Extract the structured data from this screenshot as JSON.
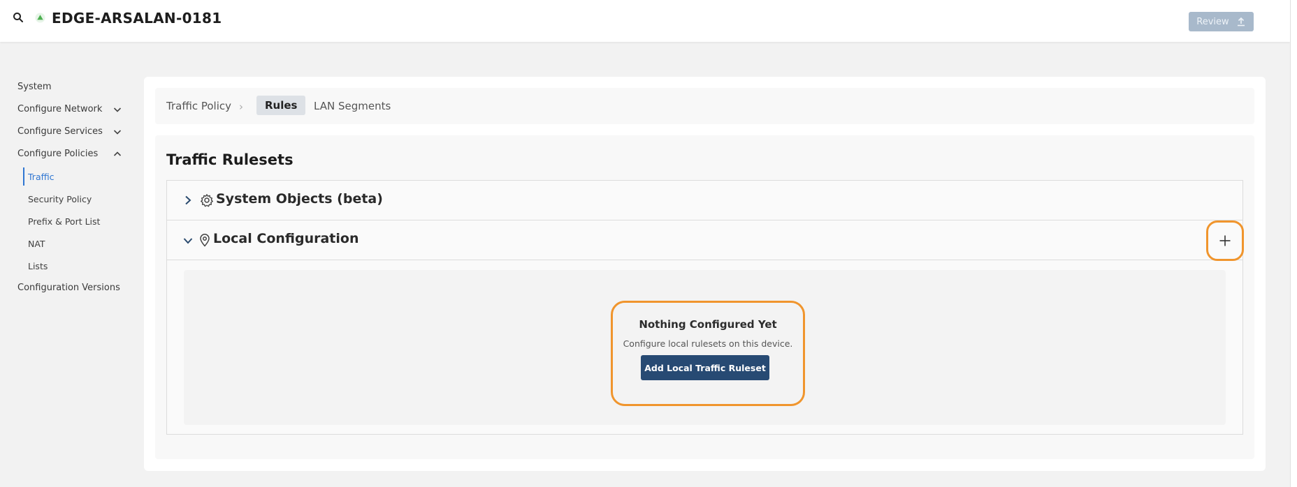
{
  "header": {
    "device_name": "EDGE-ARSALAN-0181",
    "review_label": "Review",
    "status_color": "#4caf50"
  },
  "sidebar": {
    "items": [
      {
        "label": "System"
      },
      {
        "label": "Configure Network",
        "expandable": true,
        "expanded": false
      },
      {
        "label": "Configure Services",
        "expandable": true,
        "expanded": false
      },
      {
        "label": "Configure Policies",
        "expandable": true,
        "expanded": true
      },
      {
        "label": "Configuration Versions"
      }
    ],
    "policy_subitems": [
      {
        "label": "Traffic",
        "active": true
      },
      {
        "label": "Security Policy"
      },
      {
        "label": "Prefix & Port List"
      },
      {
        "label": "NAT"
      },
      {
        "label": "Lists"
      }
    ]
  },
  "breadcrumb": {
    "root": "Traffic Policy",
    "separator": "›",
    "active": "Rules",
    "next": "LAN Segments"
  },
  "main": {
    "section_title": "Traffic Rulesets",
    "accordions": [
      {
        "title": "System Objects (beta)",
        "icon": "gear-icon",
        "expanded": false
      },
      {
        "title": "Local Configuration",
        "icon": "location-pin-icon",
        "expanded": true
      }
    ],
    "empty_state": {
      "title": "Nothing Configured Yet",
      "description": "Configure local rulesets on this device.",
      "button_label": "Add Local Traffic Ruleset"
    }
  },
  "colors": {
    "accent": "#2f76d2",
    "primary_button": "#274a73",
    "highlight": "#f0952d"
  }
}
